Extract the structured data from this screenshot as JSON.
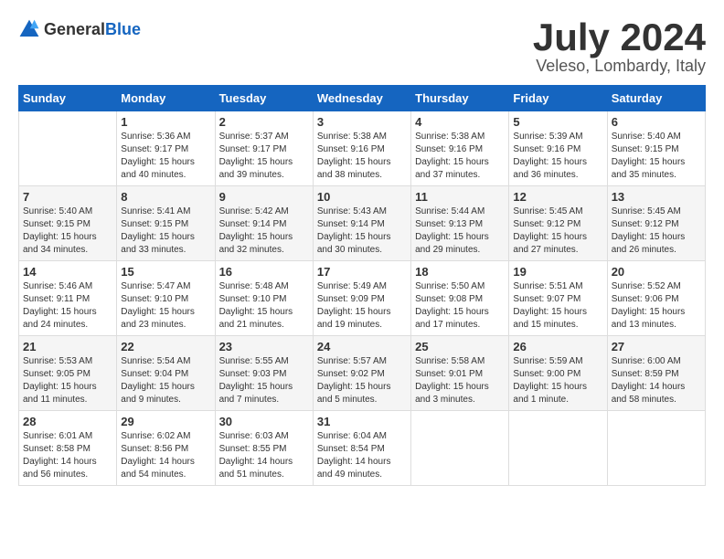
{
  "header": {
    "logo_general": "General",
    "logo_blue": "Blue",
    "month_year": "July 2024",
    "location": "Veleso, Lombardy, Italy"
  },
  "weekdays": [
    "Sunday",
    "Monday",
    "Tuesday",
    "Wednesday",
    "Thursday",
    "Friday",
    "Saturday"
  ],
  "weeks": [
    [
      {
        "day": "",
        "sunrise": "",
        "sunset": "",
        "daylight": ""
      },
      {
        "day": "1",
        "sunrise": "Sunrise: 5:36 AM",
        "sunset": "Sunset: 9:17 PM",
        "daylight": "Daylight: 15 hours and 40 minutes."
      },
      {
        "day": "2",
        "sunrise": "Sunrise: 5:37 AM",
        "sunset": "Sunset: 9:17 PM",
        "daylight": "Daylight: 15 hours and 39 minutes."
      },
      {
        "day": "3",
        "sunrise": "Sunrise: 5:38 AM",
        "sunset": "Sunset: 9:16 PM",
        "daylight": "Daylight: 15 hours and 38 minutes."
      },
      {
        "day": "4",
        "sunrise": "Sunrise: 5:38 AM",
        "sunset": "Sunset: 9:16 PM",
        "daylight": "Daylight: 15 hours and 37 minutes."
      },
      {
        "day": "5",
        "sunrise": "Sunrise: 5:39 AM",
        "sunset": "Sunset: 9:16 PM",
        "daylight": "Daylight: 15 hours and 36 minutes."
      },
      {
        "day": "6",
        "sunrise": "Sunrise: 5:40 AM",
        "sunset": "Sunset: 9:15 PM",
        "daylight": "Daylight: 15 hours and 35 minutes."
      }
    ],
    [
      {
        "day": "7",
        "sunrise": "Sunrise: 5:40 AM",
        "sunset": "Sunset: 9:15 PM",
        "daylight": "Daylight: 15 hours and 34 minutes."
      },
      {
        "day": "8",
        "sunrise": "Sunrise: 5:41 AM",
        "sunset": "Sunset: 9:15 PM",
        "daylight": "Daylight: 15 hours and 33 minutes."
      },
      {
        "day": "9",
        "sunrise": "Sunrise: 5:42 AM",
        "sunset": "Sunset: 9:14 PM",
        "daylight": "Daylight: 15 hours and 32 minutes."
      },
      {
        "day": "10",
        "sunrise": "Sunrise: 5:43 AM",
        "sunset": "Sunset: 9:14 PM",
        "daylight": "Daylight: 15 hours and 30 minutes."
      },
      {
        "day": "11",
        "sunrise": "Sunrise: 5:44 AM",
        "sunset": "Sunset: 9:13 PM",
        "daylight": "Daylight: 15 hours and 29 minutes."
      },
      {
        "day": "12",
        "sunrise": "Sunrise: 5:45 AM",
        "sunset": "Sunset: 9:12 PM",
        "daylight": "Daylight: 15 hours and 27 minutes."
      },
      {
        "day": "13",
        "sunrise": "Sunrise: 5:45 AM",
        "sunset": "Sunset: 9:12 PM",
        "daylight": "Daylight: 15 hours and 26 minutes."
      }
    ],
    [
      {
        "day": "14",
        "sunrise": "Sunrise: 5:46 AM",
        "sunset": "Sunset: 9:11 PM",
        "daylight": "Daylight: 15 hours and 24 minutes."
      },
      {
        "day": "15",
        "sunrise": "Sunrise: 5:47 AM",
        "sunset": "Sunset: 9:10 PM",
        "daylight": "Daylight: 15 hours and 23 minutes."
      },
      {
        "day": "16",
        "sunrise": "Sunrise: 5:48 AM",
        "sunset": "Sunset: 9:10 PM",
        "daylight": "Daylight: 15 hours and 21 minutes."
      },
      {
        "day": "17",
        "sunrise": "Sunrise: 5:49 AM",
        "sunset": "Sunset: 9:09 PM",
        "daylight": "Daylight: 15 hours and 19 minutes."
      },
      {
        "day": "18",
        "sunrise": "Sunrise: 5:50 AM",
        "sunset": "Sunset: 9:08 PM",
        "daylight": "Daylight: 15 hours and 17 minutes."
      },
      {
        "day": "19",
        "sunrise": "Sunrise: 5:51 AM",
        "sunset": "Sunset: 9:07 PM",
        "daylight": "Daylight: 15 hours and 15 minutes."
      },
      {
        "day": "20",
        "sunrise": "Sunrise: 5:52 AM",
        "sunset": "Sunset: 9:06 PM",
        "daylight": "Daylight: 15 hours and 13 minutes."
      }
    ],
    [
      {
        "day": "21",
        "sunrise": "Sunrise: 5:53 AM",
        "sunset": "Sunset: 9:05 PM",
        "daylight": "Daylight: 15 hours and 11 minutes."
      },
      {
        "day": "22",
        "sunrise": "Sunrise: 5:54 AM",
        "sunset": "Sunset: 9:04 PM",
        "daylight": "Daylight: 15 hours and 9 minutes."
      },
      {
        "day": "23",
        "sunrise": "Sunrise: 5:55 AM",
        "sunset": "Sunset: 9:03 PM",
        "daylight": "Daylight: 15 hours and 7 minutes."
      },
      {
        "day": "24",
        "sunrise": "Sunrise: 5:57 AM",
        "sunset": "Sunset: 9:02 PM",
        "daylight": "Daylight: 15 hours and 5 minutes."
      },
      {
        "day": "25",
        "sunrise": "Sunrise: 5:58 AM",
        "sunset": "Sunset: 9:01 PM",
        "daylight": "Daylight: 15 hours and 3 minutes."
      },
      {
        "day": "26",
        "sunrise": "Sunrise: 5:59 AM",
        "sunset": "Sunset: 9:00 PM",
        "daylight": "Daylight: 15 hours and 1 minute."
      },
      {
        "day": "27",
        "sunrise": "Sunrise: 6:00 AM",
        "sunset": "Sunset: 8:59 PM",
        "daylight": "Daylight: 14 hours and 58 minutes."
      }
    ],
    [
      {
        "day": "28",
        "sunrise": "Sunrise: 6:01 AM",
        "sunset": "Sunset: 8:58 PM",
        "daylight": "Daylight: 14 hours and 56 minutes."
      },
      {
        "day": "29",
        "sunrise": "Sunrise: 6:02 AM",
        "sunset": "Sunset: 8:56 PM",
        "daylight": "Daylight: 14 hours and 54 minutes."
      },
      {
        "day": "30",
        "sunrise": "Sunrise: 6:03 AM",
        "sunset": "Sunset: 8:55 PM",
        "daylight": "Daylight: 14 hours and 51 minutes."
      },
      {
        "day": "31",
        "sunrise": "Sunrise: 6:04 AM",
        "sunset": "Sunset: 8:54 PM",
        "daylight": "Daylight: 14 hours and 49 minutes."
      },
      {
        "day": "",
        "sunrise": "",
        "sunset": "",
        "daylight": ""
      },
      {
        "day": "",
        "sunrise": "",
        "sunset": "",
        "daylight": ""
      },
      {
        "day": "",
        "sunrise": "",
        "sunset": "",
        "daylight": ""
      }
    ]
  ]
}
